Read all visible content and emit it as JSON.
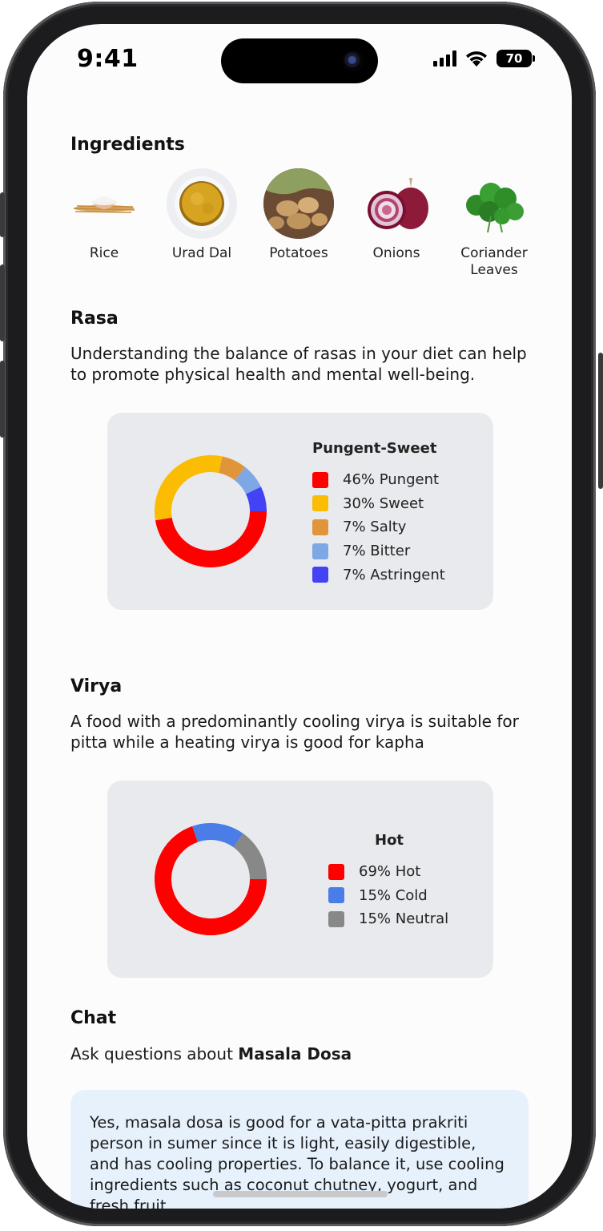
{
  "status_bar": {
    "time": "9:41",
    "battery": "70"
  },
  "ingredients": {
    "title": "Ingredients",
    "items": [
      {
        "label": "Rice",
        "icon": "rice-icon"
      },
      {
        "label": "Urad Dal",
        "icon": "urad-dal-icon"
      },
      {
        "label": "Potatoes",
        "icon": "potatoes-icon"
      },
      {
        "label": "Onions",
        "icon": "onions-icon"
      },
      {
        "label": "Coriander Leaves",
        "icon": "coriander-icon"
      }
    ]
  },
  "rasa": {
    "title": "Rasa",
    "description": "Understanding the balance of rasas in your diet can help to promote physical health and mental well-being.",
    "legend": [
      "46% Pungent",
      "30% Sweet",
      "7% Salty",
      "7% Bitter",
      "7% Astringent"
    ]
  },
  "virya": {
    "title": "Virya",
    "description": "A food with a predominantly cooling virya is suitable  for pitta while a heating virya is good for kapha",
    "legend": [
      "69% Hot",
      "15% Cold",
      "15% Neutral"
    ]
  },
  "chat": {
    "title": "Chat",
    "prompt_prefix": "Ask questions about ",
    "dish": "Masala Dosa",
    "message": "Yes, masala dosa is good for a vata-pitta prakriti person in sumer since it is light, easily digestible, and has cooling properties. To balance it, use cooling ingredients such as coconut chutney, yogurt, and fresh fruit."
  },
  "chart_data": [
    {
      "type": "pie",
      "title": "Pungent-Sweet",
      "categories": [
        "Pungent",
        "Sweet",
        "Salty",
        "Bitter",
        "Astringent"
      ],
      "values": [
        46,
        30,
        7,
        7,
        7
      ],
      "colors": [
        "#ff0000",
        "#fbbc04",
        "#e0953a",
        "#7ea7e6",
        "#4343f5"
      ],
      "legend": "right"
    },
    {
      "type": "pie",
      "title": "Hot",
      "categories": [
        "Hot",
        "Cold",
        "Neutral"
      ],
      "values": [
        69,
        15,
        15
      ],
      "colors": [
        "#ff0000",
        "#4a7ee6",
        "#888888"
      ],
      "legend": "right"
    }
  ]
}
